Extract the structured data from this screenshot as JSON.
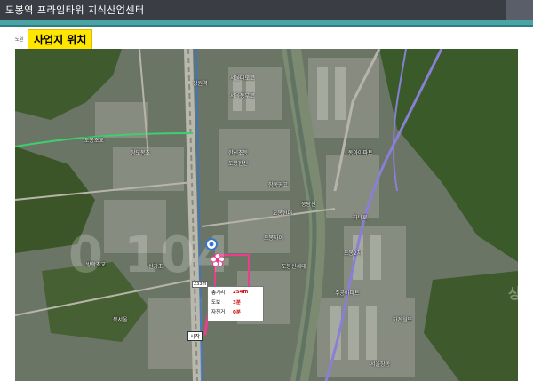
{
  "header": {
    "title": "도봉역 프라임타워 지식산업센터"
  },
  "section": {
    "badge": "사업지 위치",
    "tiny_label": "노원"
  },
  "watermark": {
    "main": "0 104",
    "side": "상"
  },
  "map_labels": [
    "도봉초교",
    "서울대도로",
    "서울동부로",
    "한신초등",
    "도봉한신",
    "창동공고",
    "중랑천",
    "도봉현대",
    "도봉자이",
    "동아아파트",
    "도봉2차",
    "하계월드",
    "서울창동",
    "창도봉초",
    "방학초교",
    "주공아파트",
    "하나로",
    "도봉신세대",
    "북서울",
    "신창초",
    "창원역"
  ],
  "start_tag": "시작",
  "dist_tag": "233m",
  "info": {
    "rows": [
      {
        "key": "총거리",
        "value": "254m"
      },
      {
        "key": "도보",
        "value": "3분"
      },
      {
        "key": "자전거",
        "value": "0분"
      }
    ]
  },
  "colors": {
    "title_bar": "#3a3d44",
    "accent_teal": "#4aa3a5",
    "badge": "#ffe600",
    "route": "#e83e8c"
  }
}
